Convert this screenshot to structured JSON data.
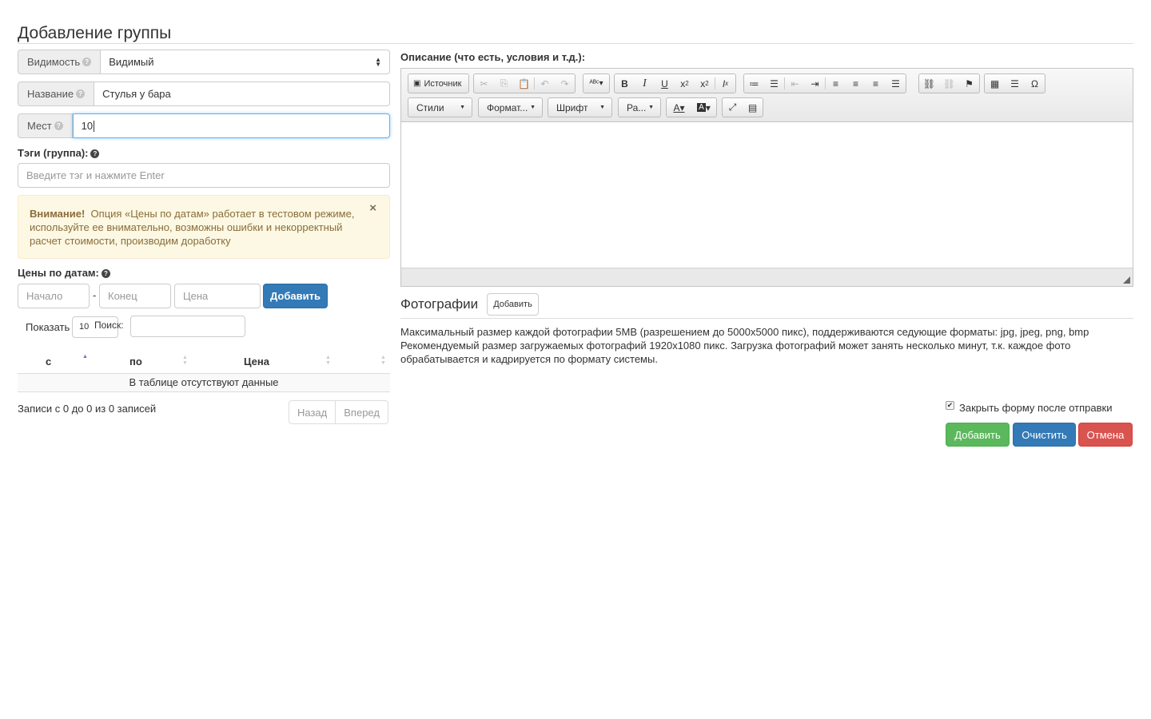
{
  "page_title": "Добавление группы",
  "visibility": {
    "label": "Видимость",
    "value": "Видимый"
  },
  "name_field": {
    "label": "Название",
    "value": "Стулья у бара"
  },
  "seats_field": {
    "label": "Мест",
    "value": "10"
  },
  "tags": {
    "label": "Тэги (группа):",
    "placeholder": "Введите тэг и нажмите Enter"
  },
  "alert": {
    "strong": "Внимание!",
    "text": "Опция «Цены по датам» работает в тестовом режиме, используйте ее внимательно, возможны ошибки и некорректный расчет стоимости, производим доработку",
    "close": "×"
  },
  "date_prices": {
    "label": "Цены по датам:",
    "start_placeholder": "Начало",
    "dash": "-",
    "end_placeholder": "Конец",
    "price_placeholder": "Цена",
    "add_button": "Добавить"
  },
  "datatable": {
    "show_label": "Показать",
    "length_value": "10",
    "search_label": "Поиск:",
    "columns": [
      "с",
      "по",
      "Цена"
    ],
    "empty_text": "В таблице отсутствуют данные",
    "info": "Записи с 0 до 0 из 0 записей",
    "prev": "Назад",
    "next": "Вперед"
  },
  "description": {
    "label": "Описание (что есть, условия и т.д.):",
    "source_button": "Источник",
    "combos": [
      "Стили",
      "Формат...",
      "Шрифт",
      "Ра..."
    ]
  },
  "photos": {
    "title": "Фотографии",
    "add_button": "Добавить",
    "line1": "Максимальный размер каждой фотографии 5MB (разрешением до 5000x5000 пикс), поддерживаются седующие форматы: jpg, jpeg, png, bmp",
    "line2": "Рекомендуемый размер загружаемых фотографий 1920x1080 пикс. Загрузка фотографий может занять несколько минут, т.к. каждое фото обрабатывается и кадрируется по формату системы."
  },
  "form": {
    "close_after_submit": "Закрыть форму после отправки",
    "close_after_submit_checked": true,
    "submit": "Добавить",
    "clear": "Очистить",
    "cancel": "Отмена"
  },
  "colors": {
    "primary": "#337ab7",
    "success": "#5cb85c",
    "danger": "#d9534f",
    "warning_bg": "#fcf8e3"
  }
}
